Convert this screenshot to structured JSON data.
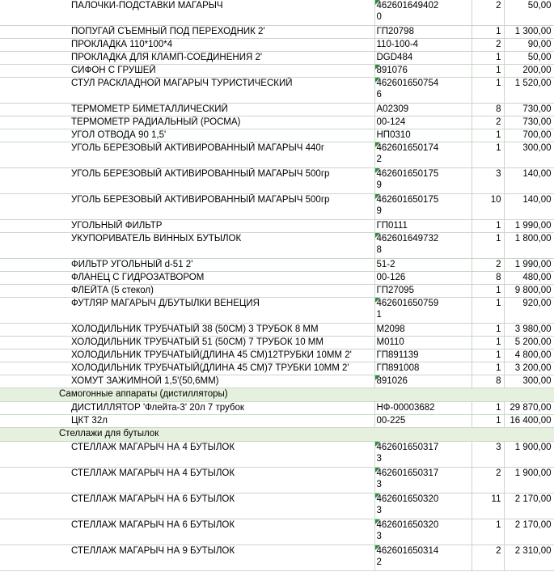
{
  "sheet": {
    "rows": [
      {
        "type": "item",
        "name": "ПАЛОЧКИ-ПОДСТАВКИ МАГАРЫЧ",
        "article": "462601649402\n0",
        "qty": "2",
        "price": "50,00",
        "flag": true
      },
      {
        "type": "item",
        "name": "ПОПУГАЙ СЪЕМНЫЙ ПОД ПЕРЕХОДНИК 2'",
        "article": "ГП20798",
        "qty": "1",
        "price": "1 300,00",
        "flag": false
      },
      {
        "type": "item",
        "name": "ПРОКЛАДКА 110*100*4",
        "article": "110-100-4",
        "qty": "2",
        "price": "90,00",
        "flag": false
      },
      {
        "type": "item",
        "name": "ПРОКЛАДКА ДЛЯ КЛАМП-СОЕДИНЕНИЯ 2'",
        "article": "DGD484",
        "qty": "1",
        "price": "50,00",
        "flag": false
      },
      {
        "type": "item",
        "name": "СИФОН С ГРУШЕЙ",
        "article": "891076",
        "qty": "1",
        "price": "200,00",
        "flag": true
      },
      {
        "type": "item",
        "name": "СТУЛ РАСКЛАДНОЙ МАГАРЫЧ ТУРИСТИЧЕСКИЙ",
        "article": "462601650754\n6",
        "qty": "1",
        "price": "1 520,00",
        "flag": true
      },
      {
        "type": "item",
        "name": "ТЕРМОМЕТР БИМЕТАЛЛИЧЕСКИЙ",
        "article": "А02309",
        "qty": "8",
        "price": "730,00",
        "flag": false
      },
      {
        "type": "item",
        "name": "ТЕРМОМЕТР РАДИАЛЬНЫЙ (РОСМА)",
        "article": "00-124",
        "qty": "2",
        "price": "730,00",
        "flag": false
      },
      {
        "type": "item",
        "name": "УГОЛ ОТВОДА 90 1,5'",
        "article": "НП0310",
        "qty": "1",
        "price": "700,00",
        "flag": false
      },
      {
        "type": "item",
        "name": "УГОЛЬ БЕРЕЗОВЫЙ АКТИВИРОВАННЫЙ МАГАРЫЧ 440г",
        "article": "462601650174\n2",
        "qty": "1",
        "price": "300,00",
        "flag": true
      },
      {
        "type": "item",
        "name": "УГОЛЬ БЕРЕЗОВЫЙ АКТИВИРОВАННЫЙ МАГАРЫЧ 500гр",
        "article": "462601650175\n9",
        "qty": "3",
        "price": "140,00",
        "flag": true
      },
      {
        "type": "item",
        "name": "УГОЛЬ БЕРЕЗОВЫЙ АКТИВИРОВАННЫЙ МАГАРЫЧ 500гр",
        "article": "462601650175\n9",
        "qty": "10",
        "price": "140,00",
        "flag": true
      },
      {
        "type": "item",
        "name": "УГОЛЬНЫЙ ФИЛЬТР",
        "article": "ГП0111",
        "qty": "1",
        "price": "1 990,00",
        "flag": false
      },
      {
        "type": "item",
        "name": "УКУПОРИВАТЕЛЬ ВИННЫХ БУТЫЛОК",
        "article": "462601649732\n8",
        "qty": "1",
        "price": "1 800,00",
        "flag": true
      },
      {
        "type": "item",
        "name": "ФИЛЬТР УГОЛЬНЫЙ d-51 2'",
        "article": "51-2",
        "qty": "2",
        "price": "1 990,00",
        "flag": false
      },
      {
        "type": "item",
        "name": "ФЛАНЕЦ С ГИДРОЗАТВОРОМ",
        "article": "00-126",
        "qty": "8",
        "price": "480,00",
        "flag": false
      },
      {
        "type": "item",
        "name": "ФЛЕЙТА (5 стекол)",
        "article": "ГП27095",
        "qty": "1",
        "price": "9 800,00",
        "flag": false
      },
      {
        "type": "item",
        "name": "ФУТЛЯР МАГАРЫЧ Д/БУТЫЛКИ ВЕНЕЦИЯ",
        "article": "462601650759\n1",
        "qty": "1",
        "price": "920,00",
        "flag": true
      },
      {
        "type": "item",
        "name": "ХОЛОДИЛЬНИК ТРУБЧАТЫЙ 38 (50СМ) 3 ТРУБОК 8 ММ",
        "article": "М2098",
        "qty": "1",
        "price": "3 980,00",
        "flag": false
      },
      {
        "type": "item",
        "name": "ХОЛОДИЛЬНИК ТРУБЧАТЫЙ 51 (50СМ) 7 ТРУБОК 10 ММ",
        "article": "М0110",
        "qty": "1",
        "price": "5 200,00",
        "flag": false
      },
      {
        "type": "item",
        "name": "ХОЛОДИЛЬНИК ТРУБЧАТЫЙ(ДЛИНА 45 СМ)12ТРУБКИ 10ММ 2'",
        "article": "ГП891139",
        "qty": "1",
        "price": "4 800,00",
        "flag": false
      },
      {
        "type": "item",
        "name": "ХОЛОДИЛЬНИК ТРУБЧАТЫЙ(ДЛИНА 45 СМ)7 ТРУБКИ 10ММ 2'",
        "article": "ГП891008",
        "qty": "1",
        "price": "3 200,00",
        "flag": false
      },
      {
        "type": "item",
        "name": "ХОМУТ ЗАЖИМНОЙ 1,5'(50,6ММ)",
        "article": "891026",
        "qty": "8",
        "price": "300,00",
        "flag": true
      },
      {
        "type": "group",
        "name": "Самогонные аппараты (дистилляторы)"
      },
      {
        "type": "item",
        "name": "ДИСТИЛЛЯТОР 'Флейта-3' 20л 7 трубок",
        "article": "НФ-00003682",
        "qty": "1",
        "price": "29 870,00",
        "flag": false
      },
      {
        "type": "item",
        "name": "ЦКТ 32л",
        "article": "00-225",
        "qty": "1",
        "price": "16 400,00",
        "flag": false
      },
      {
        "type": "group",
        "name": "Стеллажи для бутылок"
      },
      {
        "type": "item",
        "name": "СТЕЛЛАЖ МАГАРЫЧ НА 4 БУТЫЛОК",
        "article": "462601650317\n3",
        "qty": "3",
        "price": "1 900,00",
        "flag": true
      },
      {
        "type": "item",
        "name": "СТЕЛЛАЖ МАГАРЫЧ НА 4 БУТЫЛОК",
        "article": "462601650317\n3",
        "qty": "2",
        "price": "1 900,00",
        "flag": true
      },
      {
        "type": "item",
        "name": "СТЕЛЛАЖ МАГАРЫЧ НА 6 БУТЫЛОК",
        "article": "462601650320\n3",
        "qty": "11",
        "price": "2 170,00",
        "flag": true
      },
      {
        "type": "item",
        "name": "СТЕЛЛАЖ МАГАРЫЧ НА 6 БУТЫЛОК",
        "article": "462601650320\n3",
        "qty": "1",
        "price": "2 170,00",
        "flag": true
      },
      {
        "type": "item",
        "name": "СТЕЛЛАЖ МАГАРЫЧ НА 9 БУТЫЛОК",
        "article": "462601650314\n2",
        "qty": "2",
        "price": "2 310,00",
        "flag": true
      }
    ]
  }
}
